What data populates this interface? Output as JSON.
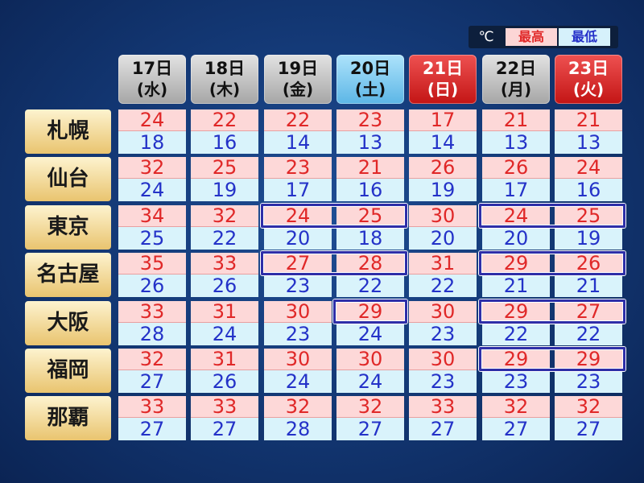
{
  "legend": {
    "unit": "℃",
    "high_label": "最高",
    "low_label": "最低"
  },
  "days": [
    {
      "date": "17日",
      "weekday": "(水)",
      "style": "gray"
    },
    {
      "date": "18日",
      "weekday": "(木)",
      "style": "gray"
    },
    {
      "date": "19日",
      "weekday": "(金)",
      "style": "gray"
    },
    {
      "date": "20日",
      "weekday": "(土)",
      "style": "sat"
    },
    {
      "date": "21日",
      "weekday": "(日)",
      "style": "red"
    },
    {
      "date": "22日",
      "weekday": "(月)",
      "style": "gray"
    },
    {
      "date": "23日",
      "weekday": "(火)",
      "style": "red"
    }
  ],
  "cities": [
    {
      "name": "札幌",
      "highs": [
        "24",
        "22",
        "22",
        "23",
        "17",
        "21",
        "21"
      ],
      "lows": [
        "18",
        "16",
        "14",
        "13",
        "14",
        "13",
        "13"
      ]
    },
    {
      "name": "仙台",
      "highs": [
        "32",
        "25",
        "23",
        "21",
        "26",
        "26",
        "24"
      ],
      "lows": [
        "24",
        "19",
        "17",
        "16",
        "19",
        "17",
        "16"
      ]
    },
    {
      "name": "東京",
      "highs": [
        "34",
        "32",
        "24",
        "25",
        "30",
        "24",
        "25"
      ],
      "lows": [
        "25",
        "22",
        "20",
        "18",
        "20",
        "20",
        "19"
      ]
    },
    {
      "name": "名古屋",
      "highs": [
        "35",
        "33",
        "27",
        "28",
        "31",
        "29",
        "26"
      ],
      "lows": [
        "26",
        "26",
        "23",
        "22",
        "22",
        "21",
        "21"
      ]
    },
    {
      "name": "大阪",
      "highs": [
        "33",
        "31",
        "30",
        "29",
        "30",
        "29",
        "27"
      ],
      "lows": [
        "28",
        "24",
        "23",
        "24",
        "23",
        "22",
        "22"
      ]
    },
    {
      "name": "福岡",
      "highs": [
        "32",
        "31",
        "30",
        "30",
        "30",
        "29",
        "29"
      ],
      "lows": [
        "27",
        "26",
        "24",
        "24",
        "23",
        "23",
        "23"
      ]
    },
    {
      "name": "那覇",
      "highs": [
        "33",
        "33",
        "32",
        "32",
        "33",
        "32",
        "32"
      ],
      "lows": [
        "27",
        "27",
        "28",
        "27",
        "27",
        "27",
        "27"
      ]
    }
  ],
  "highlights": [
    {
      "row": 2,
      "from": 2,
      "to": 3
    },
    {
      "row": 2,
      "from": 5,
      "to": 6
    },
    {
      "row": 3,
      "from": 2,
      "to": 3
    },
    {
      "row": 3,
      "from": 5,
      "to": 6
    },
    {
      "row": 4,
      "from": 3,
      "to": 3
    },
    {
      "row": 4,
      "from": 5,
      "to": 6
    },
    {
      "row": 5,
      "from": 5,
      "to": 6
    }
  ],
  "colors": {
    "high_text": "#e02828",
    "low_text": "#2432c8",
    "highlight_border": "#2e2ea8"
  }
}
